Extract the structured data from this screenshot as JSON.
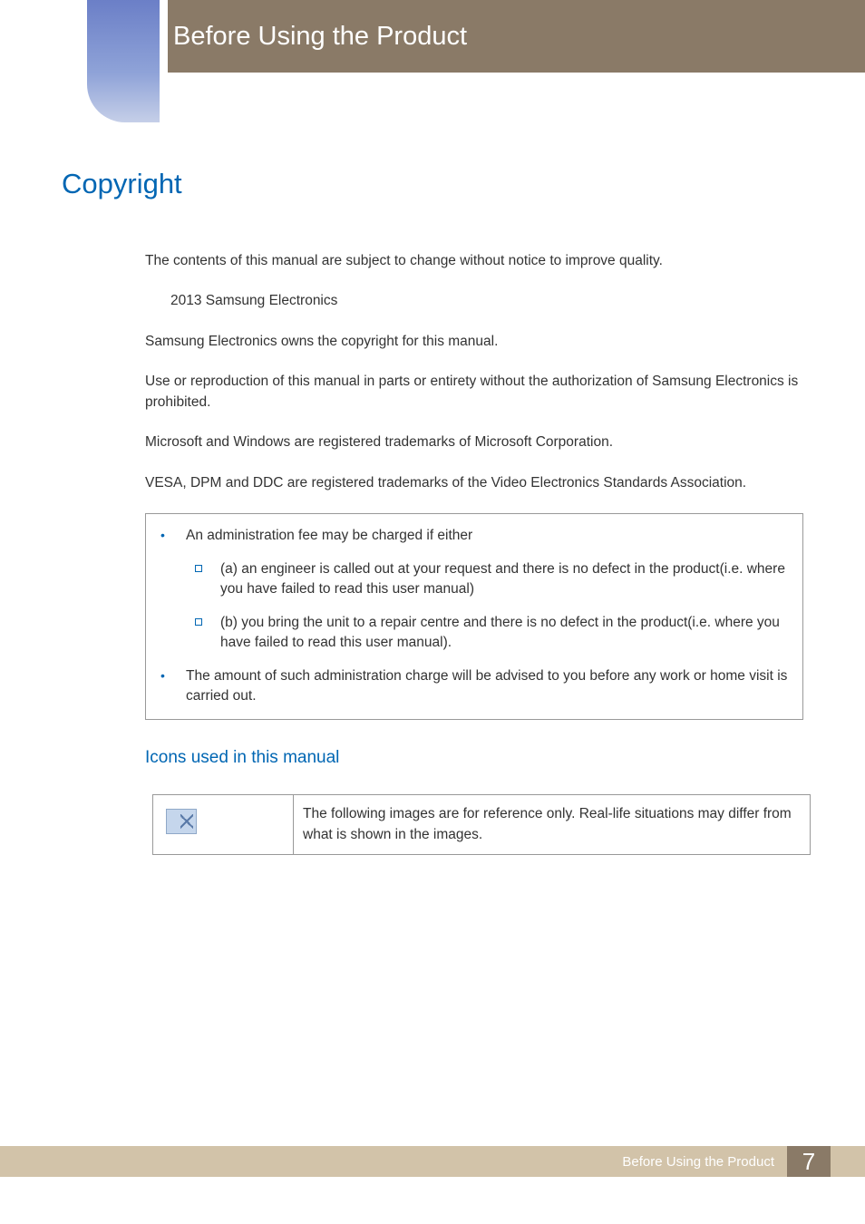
{
  "header": {
    "title": "Before Using the Product"
  },
  "section": {
    "title": "Copyright"
  },
  "body": {
    "p1": "The contents of this manual are subject to change without notice to improve quality.",
    "p2_prefix": "",
    "p2": " 2013 Samsung Electronics",
    "p3": "Samsung Electronics owns the copyright for this manual.",
    "p4": "Use or reproduction of this manual in parts or entirety without the authorization of Samsung Electronics is prohibited.",
    "p5": "Microsoft and Windows are registered trademarks of Microsoft Corporation.",
    "p6": "VESA, DPM and DDC are registered trademarks of the Video Electronics Standards Association."
  },
  "notice": {
    "item1": "An administration fee may be charged if either",
    "item1a": "(a) an engineer is called out at your request and there is no defect in the product(i.e. where you have failed to read this user manual)",
    "item1b": "(b) you bring the unit to a repair centre and there is no defect in the product(i.e. where you have failed to read this user manual).",
    "item2": "The amount of such administration charge will be advised to you before any work or home visit is carried out."
  },
  "subsection": {
    "title": "Icons used in this manual"
  },
  "icon_table": {
    "row1_text": "The following images are for reference only. Real-life situations may differ from what is shown in the images."
  },
  "footer": {
    "text": "Before Using the Product",
    "page": "7"
  }
}
